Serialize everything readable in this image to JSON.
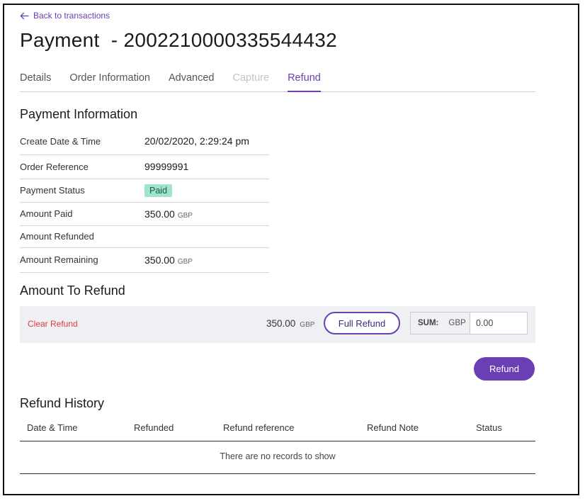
{
  "nav": {
    "back_label": "Back to transactions"
  },
  "header": {
    "title": "Payment  - 2002210000335544432"
  },
  "tabs": [
    {
      "label": "Details",
      "state": "normal"
    },
    {
      "label": "Order Information",
      "state": "normal"
    },
    {
      "label": "Advanced",
      "state": "normal"
    },
    {
      "label": "Capture",
      "state": "disabled"
    },
    {
      "label": "Refund",
      "state": "active"
    }
  ],
  "payment_info": {
    "title": "Payment Information",
    "rows": {
      "create_date": {
        "label": "Create Date & Time",
        "value": "20/02/2020, 2:29:24 pm"
      },
      "order_ref": {
        "label": "Order Reference",
        "value": "99999991"
      },
      "status": {
        "label": "Payment Status",
        "value": "Paid"
      },
      "amount_paid": {
        "label": "Amount Paid",
        "value": "350.00",
        "currency": "GBP"
      },
      "amount_refunded": {
        "label": "Amount Refunded",
        "value": ""
      },
      "amount_remaining": {
        "label": "Amount Remaining",
        "value": "350.00",
        "currency": "GBP"
      }
    }
  },
  "refund": {
    "title": "Amount To Refund",
    "clear_label": "Clear Refund",
    "amount": "350.00",
    "currency": "GBP",
    "full_refund_label": "Full Refund",
    "sum_label": "SUM:",
    "sum_currency": "GBP",
    "sum_value": "0.00",
    "submit_label": "Refund"
  },
  "history": {
    "title": "Refund History",
    "columns": [
      "Date & Time",
      "Refunded",
      "Refund reference",
      "Refund Note",
      "Status"
    ],
    "empty_text": "There are no records to show"
  },
  "colors": {
    "accent": "#6a3fb4",
    "paid_badge": "#9fe4cf",
    "danger": "#e03a3a"
  }
}
